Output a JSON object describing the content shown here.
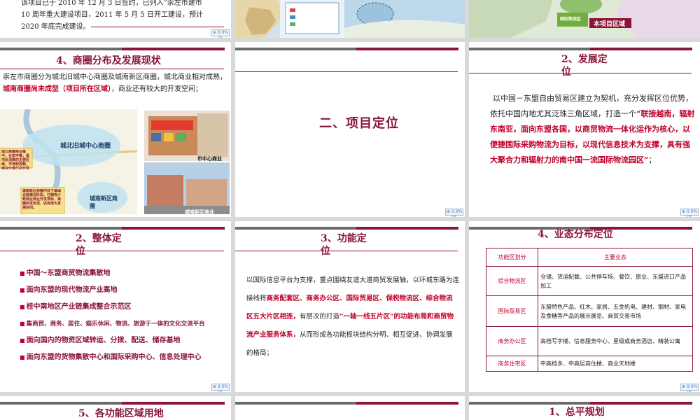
{
  "s1": {
    "line1": "该项目已于 2010 年 12 月 3 日签约，已列入“崇左市建市",
    "line2": "10 周年重大建设项目，2011 年 5 月 5 日开工建设，预计",
    "line3": "2020 年底完成建设。"
  },
  "s3": {
    "tag": "本项目区域",
    "tag2": "国际物流区"
  },
  "s4": {
    "title": "4、商圈分布及发展现状",
    "text_a": "崇左市商圈分为城北旧城中心商圈及城南新区商圈，城北商业相对成熟，",
    "text_red": "城南商圈尚未成型（项目所在区域）",
    "text_b": "，商业还有较大的开发空间；",
    "map_label1": "城北旧城中心商圈",
    "map_label2": "城南新区商圈",
    "note1": "城北商圈商业集中，业态丰富，是市民消费的主要区域，市场较成熟，商业价值已充分显现。",
    "note2": "城南新区商圈内处于基础设施建设阶段，已拥有少数商业商业开发项目，商圈尚未形成，还有很大发展空间。",
    "photo1_cap": "市中心商业",
    "photo2_cap": "城南新区商业"
  },
  "s5": {
    "title": "二、项目定位"
  },
  "s6": {
    "title1": "2、发展定",
    "title2": "位",
    "text_a": "以中国－东盟自由贸易区建立为契机，充分发挥区位优势，依托中国内地尤其泛珠三角区域，打造一个",
    "text_red": "“联接越南，辐射东南亚，面向东盟各国，以商贸物流一体化运作为核心，以便捷国际采购物流为目标，以现代信息技术为支撑，具有强大聚合力和辐射力的南中国一流国际物流园区”",
    "text_b": "；"
  },
  "s7": {
    "title1": "2、整体定",
    "title2": "位",
    "items": [
      "中国～东盟商贸物流集散地",
      "面向东盟的现代物流产业高地",
      "桂中南地区产业链集成整合示范区",
      "集商贸、商务、居住、娱乐休闲、物流、旅游于一体的文化交流平台",
      "面向国内的物资区域转运、分拨、配送、储存基地",
      "面向东盟的货物集散中心和国际采购中心、信息处理中心"
    ]
  },
  "s8": {
    "title1": "3、功能定",
    "title2": "位",
    "text_a": "以国际信息平台为支撑，重点围绕友谊大道商贸发展轴，以环城东路为连接线将",
    "text_red1": "商务配套区、商务办公区、国际贸易区、保税物流区、综合物流区五大片区相连，",
    "text_mid": "有层次的打造",
    "text_red2": "“一轴一线五片区”",
    "text_red3": "的功能布局和商贸物流产业服务体系，",
    "text_b": "从而形成各功能板块结构分明、相互促进、协调发展的格局；"
  },
  "s9": {
    "title": "4、业态分布定位",
    "col1": "功能区划分",
    "col2": "主要业态",
    "rows": [
      {
        "k": "综合物流区",
        "v": "仓储、货运配载、公共停车场、餐饮、旅业、东盟进口产品加工"
      },
      {
        "k": "国际贸易区",
        "v": "东盟特色产品、红木、家居、五金机电、建材、钢材、家电及食糖等产品的展示展览、商贸交易市场"
      },
      {
        "k": "商务办公区",
        "v": "高档写字楼、信息服务中心、星级或商务酒店、精装公寓"
      },
      {
        "k": "商务住宅区",
        "v": "中高档多、中高层商住楼、商业天地楼"
      }
    ]
  },
  "s10": {
    "title": "5、各功能区域用地"
  },
  "s12": {
    "title": "1、总平规划"
  },
  "logo": "⊕ 0.0%(S",
  "colors": {
    "accent": "#8a1538",
    "red": "#c0002a",
    "gray_bar": "#6b6b6b"
  }
}
